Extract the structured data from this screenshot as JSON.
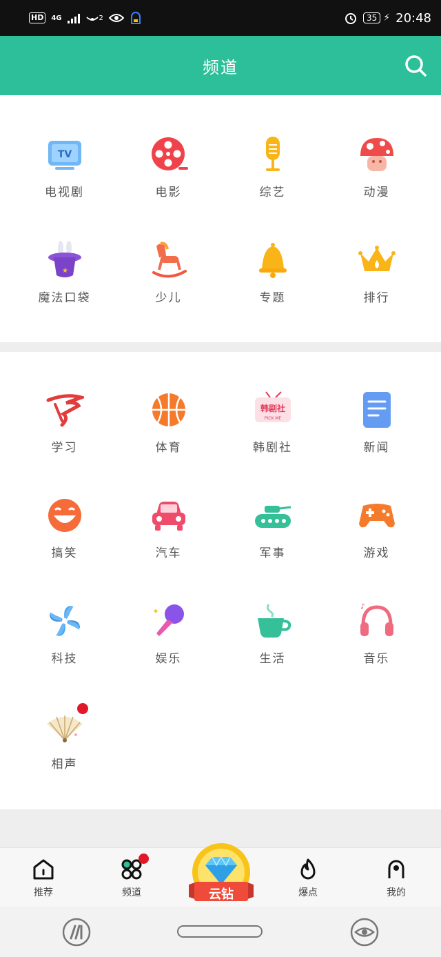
{
  "status_bar": {
    "hd": "HD",
    "network": "4G",
    "notif_count": "2",
    "battery": "35",
    "time": "20:48"
  },
  "header": {
    "title": "频道"
  },
  "panel1": {
    "items": [
      {
        "label": "电视剧",
        "icon": "tv-icon"
      },
      {
        "label": "电影",
        "icon": "film-reel-icon"
      },
      {
        "label": "综艺",
        "icon": "microphone-icon"
      },
      {
        "label": "动漫",
        "icon": "mushroom-icon"
      },
      {
        "label": "魔法口袋",
        "icon": "magic-hat-icon"
      },
      {
        "label": "少儿",
        "icon": "rocking-horse-icon"
      },
      {
        "label": "专题",
        "icon": "bell-icon"
      },
      {
        "label": "排行",
        "icon": "crown-icon"
      }
    ]
  },
  "panel2": {
    "items": [
      {
        "label": "学习",
        "icon": "study-icon"
      },
      {
        "label": "体育",
        "icon": "basketball-icon"
      },
      {
        "label": "韩剧社",
        "icon": "korean-drama-tv-icon",
        "icon_text": "韩剧社",
        "icon_subtext": "PICK ME"
      },
      {
        "label": "新闻",
        "icon": "news-document-icon"
      },
      {
        "label": "搞笑",
        "icon": "laughing-face-icon"
      },
      {
        "label": "汽车",
        "icon": "car-icon"
      },
      {
        "label": "军事",
        "icon": "tank-icon"
      },
      {
        "label": "游戏",
        "icon": "gamepad-icon"
      },
      {
        "label": "科技",
        "icon": "pinwheel-icon"
      },
      {
        "label": "娱乐",
        "icon": "karaoke-mic-icon"
      },
      {
        "label": "生活",
        "icon": "coffee-cup-icon"
      },
      {
        "label": "音乐",
        "icon": "headphones-icon"
      },
      {
        "label": "相声",
        "icon": "folding-fan-icon"
      }
    ]
  },
  "bottom_nav": {
    "items": [
      {
        "label": "推荐",
        "icon": "home-icon"
      },
      {
        "label": "频道",
        "icon": "channels-icon"
      },
      {
        "label": "云钻",
        "icon": "diamond-icon"
      },
      {
        "label": "爆点",
        "icon": "flame-icon"
      },
      {
        "label": "我的",
        "icon": "profile-icon"
      }
    ]
  },
  "colors": {
    "accent": "#2dbf99",
    "badge": "#e0182a"
  }
}
